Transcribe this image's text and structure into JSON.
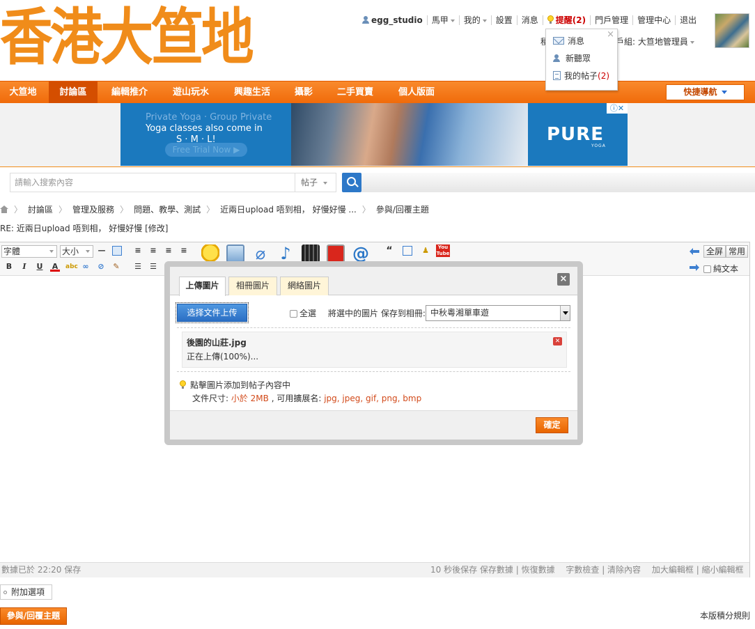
{
  "site": {
    "logo_text": "香港大笪地"
  },
  "userbar": {
    "username": "egg_studio",
    "items": [
      "馬甲",
      "我的",
      "設置",
      "消息",
      "提醒(2)",
      "門戶管理",
      "管理中心",
      "退出"
    ],
    "usergroup_left": "積",
    "usergroup": "用戶組: 大笪地管理員"
  },
  "notif_menu": {
    "close": "×",
    "messages": "消息",
    "new_listeners": "新聽眾",
    "my_posts": "我的帖子",
    "my_posts_count": "(2)"
  },
  "nav": {
    "items": [
      "大笪地",
      "討論區",
      "編輯推介",
      "遊山玩水",
      "興趣生活",
      "攝影",
      "二手買賣",
      "個人版面"
    ],
    "quick_nav": "快捷導航"
  },
  "ad": {
    "line1": "Private Yoga · Group Private",
    "line2": "Yoga classes also come in",
    "line3": "S · M · L!",
    "cta": "Free Trial Now ▶",
    "brand": "PURE",
    "brand_sub": "YOGA",
    "badge": "ⓘ✕"
  },
  "search": {
    "placeholder": "請輸入搜索內容",
    "type": "帖子"
  },
  "breadcrumb": {
    "items": [
      "討論區",
      "管理及服務",
      "問題、教學、測試",
      "近兩日upload 唔到相， 好慢好慢 ...",
      "參與/回覆主題"
    ]
  },
  "thread_title": "RE: 近兩日upload 唔到相， 好慢好慢 [修改]",
  "editor": {
    "font_select": "字體",
    "size_select": "大小",
    "fullscreen": "全屏",
    "common": "常用",
    "plain_text": "純文本",
    "status_left": "數據已於 22:20 保存",
    "status_right": "10 秒後保存 保存數據 | 恢復數據　 字數檢查 | 清除內容　 加大編輯框 | 縮小編輯框"
  },
  "dialog": {
    "tabs": [
      "上傳圖片",
      "相冊圖片",
      "網絡圖片"
    ],
    "close": "×",
    "select_file": "选择文件上传",
    "select_all": "全選",
    "album_label": "將選中的圖片 保存到相冊:",
    "album_value": "中秋粵湘單車遊",
    "file_name": "後園的山莊.jpg",
    "file_status": "正在上傳(100%)...",
    "file_delete": "✕",
    "tip": "點擊圖片添加到帖子內容中",
    "spec_prefix": "文件尺寸: ",
    "spec_size": "小於 2MB",
    "spec_mid": " , 可用擴展名: ",
    "spec_ext": "jpg, jpeg, gif, png, bmp",
    "confirm": "確定"
  },
  "bottom": {
    "attach": "附加選項",
    "submit": "參與/回覆主題",
    "rules": "本版積分規則"
  },
  "colors": {
    "brand_orange": "#f08c1a",
    "nav_orange": "#f06b0a",
    "link_blue": "#2d78c8",
    "alert_red": "#c00000"
  }
}
